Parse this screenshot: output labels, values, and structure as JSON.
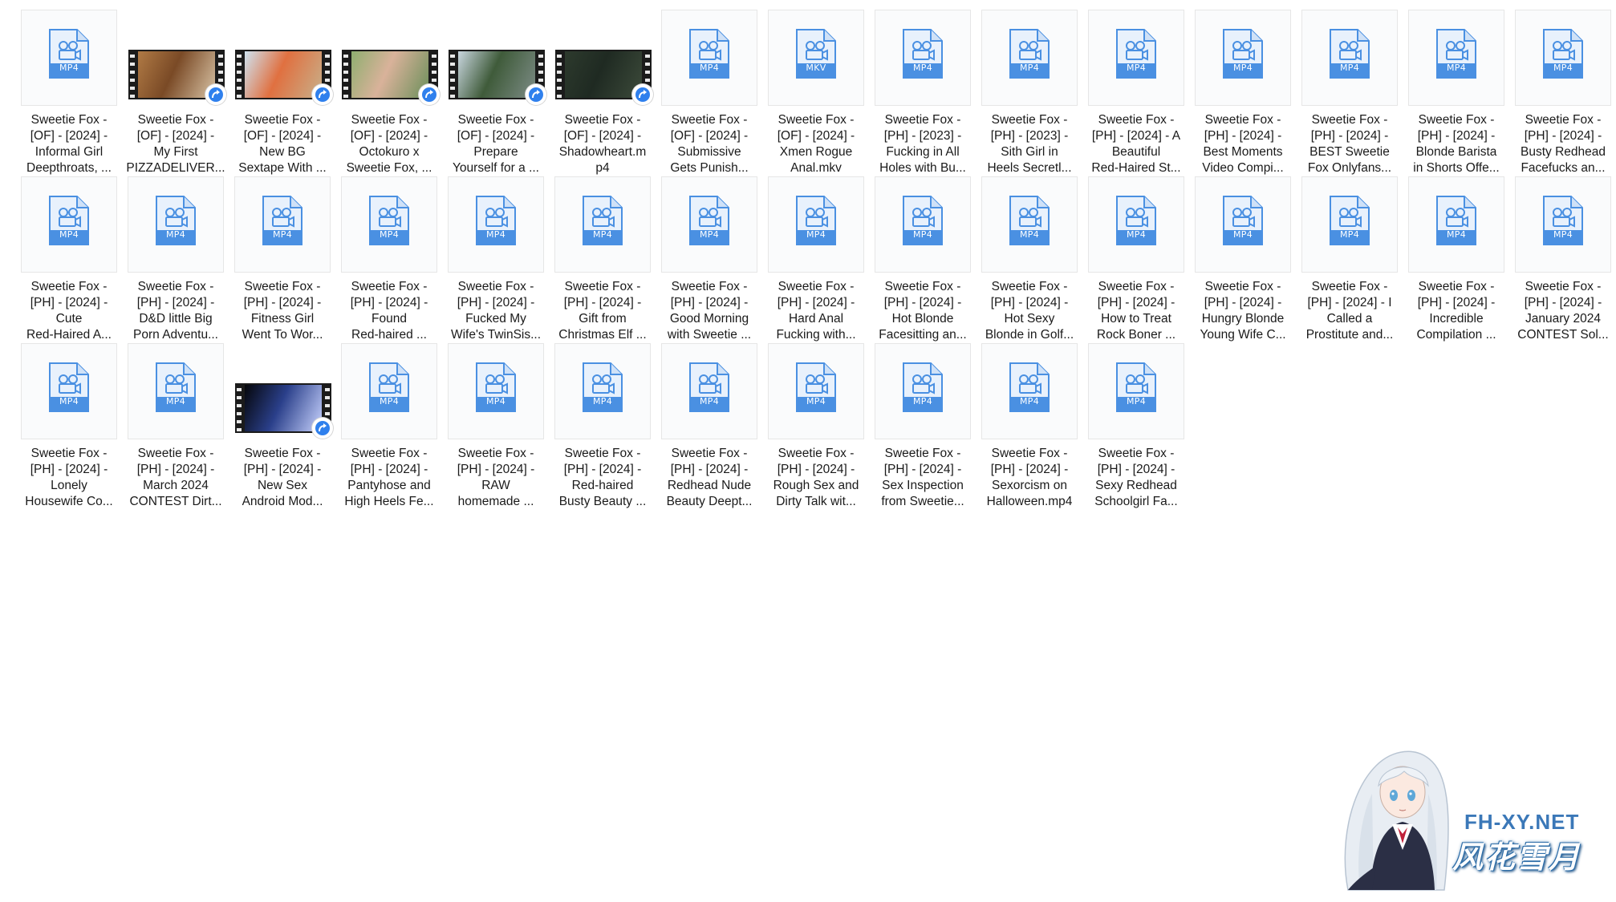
{
  "files": [
    {
      "name": "Sweetie Fox -\n[OF] - [2024] -\nInformal Girl\nDeepthroats, ...",
      "ext": "MP4",
      "thumb": "doc"
    },
    {
      "name": "Sweetie Fox -\n[OF] - [2024] -\nMy First\nPIZZADELIVER...",
      "ext": "",
      "thumb": "video",
      "frame_colors": [
        "#b07a45",
        "#7a4a26",
        "#d8c3a5"
      ]
    },
    {
      "name": "Sweetie Fox -\n[OF] - [2024] -\nNew BG\nSextape With ...",
      "ext": "",
      "thumb": "video",
      "frame_colors": [
        "#cfe2f0",
        "#e07040",
        "#c8b08a"
      ]
    },
    {
      "name": "Sweetie Fox -\n[OF] - [2024] -\nOctokuro x\nSweetie Fox, ...",
      "ext": "",
      "thumb": "video",
      "frame_colors": [
        "#8fae70",
        "#d9b29a",
        "#6b8f5a"
      ]
    },
    {
      "name": "Sweetie Fox -\n[OF] - [2024] -\nPrepare\nYourself for a ...",
      "ext": "",
      "thumb": "video",
      "frame_colors": [
        "#c9d6df",
        "#3f5b3a",
        "#7d8c86"
      ]
    },
    {
      "name": "Sweetie Fox -\n[OF] - [2024] -\nShadowheart.m\np4",
      "ext": "",
      "thumb": "video",
      "frame_colors": [
        "#2d3a2d",
        "#1f2a22",
        "#3c4a3a"
      ]
    },
    {
      "name": "Sweetie Fox -\n[OF] - [2024] -\nSubmissive\nGets Punish...",
      "ext": "MP4",
      "thumb": "doc"
    },
    {
      "name": "Sweetie Fox -\n[OF] - [2024] -\nXmen Rogue\nAnal.mkv",
      "ext": "MKV",
      "thumb": "doc"
    },
    {
      "name": "Sweetie Fox -\n[PH] - [2023] -\nFucking in All\nHoles with Bu...",
      "ext": "MP4",
      "thumb": "doc"
    },
    {
      "name": "Sweetie Fox -\n[PH] - [2023] -\nSith Girl in\nHeels Secretl...",
      "ext": "MP4",
      "thumb": "doc"
    },
    {
      "name": "Sweetie Fox -\n[PH] - [2024] - A\nBeautiful\nRed-Haired St...",
      "ext": "MP4",
      "thumb": "doc"
    },
    {
      "name": "Sweetie Fox -\n[PH] - [2024] -\nBest Moments\nVideo Compi...",
      "ext": "MP4",
      "thumb": "doc"
    },
    {
      "name": "Sweetie Fox -\n[PH] - [2024] -\nBEST Sweetie\nFox Onlyfans...",
      "ext": "MP4",
      "thumb": "doc"
    },
    {
      "name": "Sweetie Fox -\n[PH] - [2024] -\nBlonde Barista\nin Shorts Offe...",
      "ext": "MP4",
      "thumb": "doc"
    },
    {
      "name": "Sweetie Fox -\n[PH] - [2024] -\nBusty Redhead\nFacefucks an...",
      "ext": "MP4",
      "thumb": "doc"
    },
    {
      "name": "Sweetie Fox -\n[PH] - [2024] -\nCute\nRed-Haired A...",
      "ext": "MP4",
      "thumb": "doc"
    },
    {
      "name": "Sweetie Fox -\n[PH] - [2024] -\nD&D little Big\nPorn Adventu...",
      "ext": "MP4",
      "thumb": "doc"
    },
    {
      "name": "Sweetie Fox -\n[PH] - [2024] -\nFitness Girl\nWent To Wor...",
      "ext": "MP4",
      "thumb": "doc"
    },
    {
      "name": "Sweetie Fox -\n[PH] - [2024] -\nFound\nRed-haired ...",
      "ext": "MP4",
      "thumb": "doc"
    },
    {
      "name": "Sweetie Fox -\n[PH] - [2024] -\nFucked My\nWife's TwinSis...",
      "ext": "MP4",
      "thumb": "doc"
    },
    {
      "name": "Sweetie Fox -\n[PH] - [2024] -\nGift from\nChristmas Elf ...",
      "ext": "MP4",
      "thumb": "doc"
    },
    {
      "name": "Sweetie Fox -\n[PH] - [2024] -\nGood Morning\nwith Sweetie ...",
      "ext": "MP4",
      "thumb": "doc"
    },
    {
      "name": "Sweetie Fox -\n[PH] - [2024] -\nHard Anal\nFucking with...",
      "ext": "MP4",
      "thumb": "doc"
    },
    {
      "name": "Sweetie Fox -\n[PH] - [2024] -\nHot Blonde\nFacesitting an...",
      "ext": "MP4",
      "thumb": "doc"
    },
    {
      "name": "Sweetie Fox -\n[PH] - [2024] -\nHot Sexy\nBlonde in Golf...",
      "ext": "MP4",
      "thumb": "doc"
    },
    {
      "name": "Sweetie Fox -\n[PH] - [2024] -\nHow to Treat\nRock Boner ...",
      "ext": "MP4",
      "thumb": "doc"
    },
    {
      "name": "Sweetie Fox -\n[PH] - [2024] -\nHungry Blonde\nYoung Wife C...",
      "ext": "MP4",
      "thumb": "doc"
    },
    {
      "name": "Sweetie Fox -\n[PH] - [2024] - I\nCalled a\nProstitute and...",
      "ext": "MP4",
      "thumb": "doc"
    },
    {
      "name": "Sweetie Fox -\n[PH] - [2024] -\nIncredible\nCompilation ...",
      "ext": "MP4",
      "thumb": "doc"
    },
    {
      "name": "Sweetie Fox -\n[PH] - [2024] -\nJanuary 2024\nCONTEST Sol...",
      "ext": "MP4",
      "thumb": "doc"
    },
    {
      "name": "Sweetie Fox -\n[PH] - [2024] -\nLonely\nHousewife Co...",
      "ext": "MP4",
      "thumb": "doc"
    },
    {
      "name": "Sweetie Fox -\n[PH] - [2024] -\nMarch 2024\nCONTEST Dirt...",
      "ext": "MP4",
      "thumb": "doc"
    },
    {
      "name": "Sweetie Fox -\n[PH] - [2024] -\nNew Sex\nAndroid Mod...",
      "ext": "",
      "thumb": "video",
      "frame_colors": [
        "#05060a",
        "#2a3f8a",
        "#c9d4ff"
      ]
    },
    {
      "name": "Sweetie Fox -\n[PH] - [2024] -\nPantyhose and\nHigh Heels Fe...",
      "ext": "MP4",
      "thumb": "doc"
    },
    {
      "name": "Sweetie Fox -\n[PH] - [2024] -\nRAW\nhomemade ...",
      "ext": "MP4",
      "thumb": "doc"
    },
    {
      "name": "Sweetie Fox -\n[PH] - [2024] -\nRed-haired\nBusty Beauty ...",
      "ext": "MP4",
      "thumb": "doc"
    },
    {
      "name": "Sweetie Fox -\n[PH] - [2024] -\nRedhead Nude\nBeauty Deept...",
      "ext": "MP4",
      "thumb": "doc"
    },
    {
      "name": "Sweetie Fox -\n[PH] - [2024] -\nRough Sex and\nDirty Talk wit...",
      "ext": "MP4",
      "thumb": "doc"
    },
    {
      "name": "Sweetie Fox -\n[PH] - [2024] -\nSex Inspection\nfrom Sweetie...",
      "ext": "MP4",
      "thumb": "doc"
    },
    {
      "name": "Sweetie Fox -\n[PH] - [2024] -\nSexorcism on\nHalloween.mp4",
      "ext": "MP4",
      "thumb": "doc"
    },
    {
      "name": "Sweetie Fox -\n[PH] - [2024] -\nSexy Redhead\nSchoolgirl Fa...",
      "ext": "MP4",
      "thumb": "doc"
    }
  ],
  "watermark": {
    "site": "FH-XY.NET",
    "title": "风花雪月"
  },
  "colors": {
    "icon_blue": "#4a90e2",
    "icon_light": "#e8f1fc",
    "badge_blue": "#2f80ed"
  },
  "icons": {
    "doc": "video-file-icon",
    "shortcut": "shortcut-arrow-icon"
  }
}
